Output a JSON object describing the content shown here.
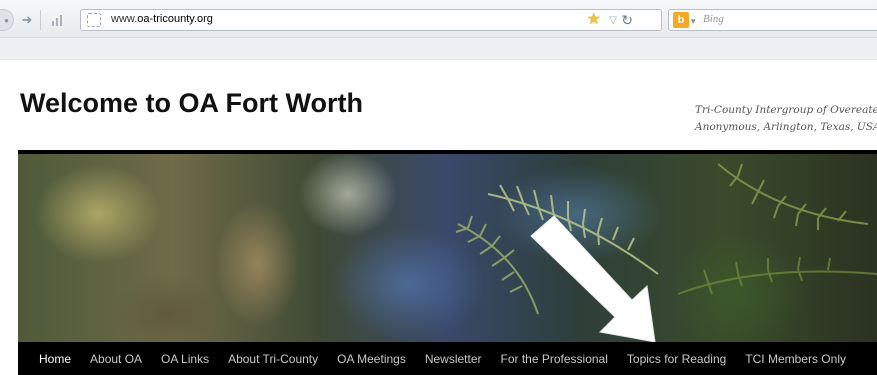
{
  "browser": {
    "url": {
      "host": "oa-tricounty.org",
      "prefix": "www."
    },
    "search_placeholder": "Bing",
    "icons": {
      "back": "back-arrow-icon",
      "forward": "forward-arrow-icon",
      "stats": "bar-chart-icon",
      "favicon": "page-icon",
      "bookmark": "star-icon",
      "dropdown": "chevron-down-icon",
      "reload": "reload-icon",
      "search_engine": "bing-icon"
    }
  },
  "site": {
    "title": "Welcome to OA Fort Worth",
    "tagline_line1": "Tri-County Intergroup of Overeaters",
    "tagline_line2": "Anonymous, Arlington, Texas, USA"
  },
  "nav": {
    "items": [
      {
        "label": "Home",
        "active": true
      },
      {
        "label": "About OA"
      },
      {
        "label": "OA Links"
      },
      {
        "label": "About Tri-County"
      },
      {
        "label": "OA Meetings"
      },
      {
        "label": "Newsletter"
      },
      {
        "label": "For the Professional"
      },
      {
        "label": "Topics for Reading"
      },
      {
        "label": "TCI Members Only"
      }
    ]
  },
  "colors": {
    "nav_background": "#000000",
    "nav_text": "#c8c8c8",
    "title_text": "#111111",
    "arrow": "#ffffff"
  }
}
